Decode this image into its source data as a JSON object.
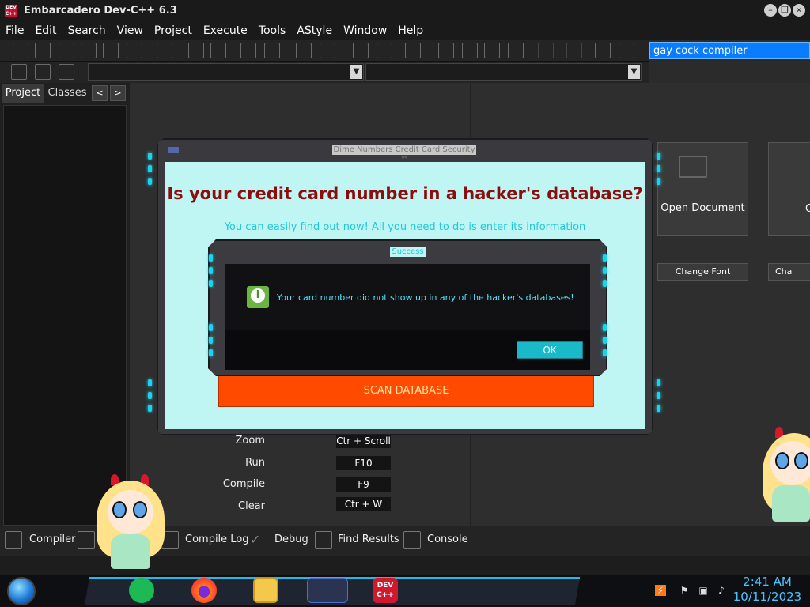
{
  "window": {
    "app_icon_text": "DEV C++",
    "title": "Embarcadero Dev-C++ 6.3"
  },
  "menu": [
    "File",
    "Edit",
    "Search",
    "View",
    "Project",
    "Execute",
    "Tools",
    "AStyle",
    "Window",
    "Help"
  ],
  "toolbar": {
    "search_value": "gay cock compiler"
  },
  "left_panel": {
    "tabs": [
      "Project",
      "Classes"
    ],
    "prev": "<",
    "next": ">"
  },
  "welcome": {
    "open_document": "Open Document",
    "change_font": "Change Font",
    "second_button_partial": "Cha",
    "second_tile_partial": "C",
    "shortcuts": [
      {
        "label": "Zoom",
        "key": "Ctr + Scroll"
      },
      {
        "label": "Run",
        "key": "F10"
      },
      {
        "label": "Compile",
        "key": "F9"
      },
      {
        "label": "Clear",
        "key": "Ctr + W"
      }
    ]
  },
  "bottom_tabs": [
    "Compiler",
    "Compile Log",
    "Debug",
    "Find Results",
    "Console"
  ],
  "outer_dialog": {
    "title": "Dime Numbers Credit Card Security ™",
    "headline": "Is your credit card number in a hacker's database?",
    "subtext": "You can easily find out now! All you need to do is enter its information",
    "scan_button": "SCAN DATABASE"
  },
  "inner_dialog": {
    "title": "Success",
    "icon_glyph": "i",
    "message": "Your card number did not show up in any of the hacker's databases!",
    "ok": "OK"
  },
  "taskbar": {
    "devcpp_label": "DEV C++",
    "time": "2:41 AM",
    "date": "10/11/2023"
  },
  "colors": {
    "accent_cyan": "#1ad4ef",
    "scan_orange": "#ff4a00",
    "headline_red": "#8b0d0d",
    "dialog_bg": "#bff5f3"
  }
}
